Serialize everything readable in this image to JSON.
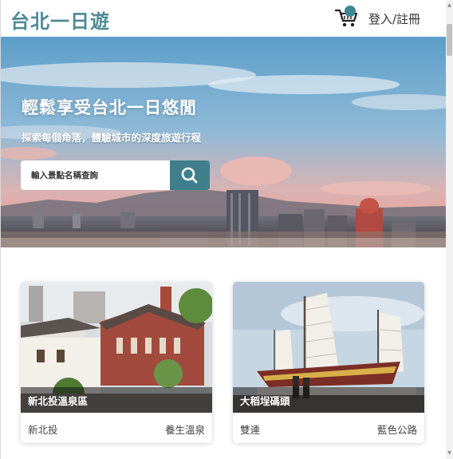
{
  "header": {
    "logo": "台北一日遊",
    "login_label": "登入/註冊",
    "cart_icon": "shopping-cart-icon"
  },
  "hero": {
    "title": "輕鬆享受台北一日悠閒",
    "subtitle": "探索每個角落，體驗城市的深度旅遊行程",
    "search_placeholder": "輸入景點名稱查詢",
    "search_icon": "search-icon"
  },
  "attractions": [
    {
      "name": "新北投溫泉區",
      "area": "新北投",
      "category": "養生溫泉"
    },
    {
      "name": "大稻埕碼頭",
      "area": "雙連",
      "category": "藍色公路"
    }
  ],
  "colors": {
    "brand": "#4f8a95",
    "search_button": "#3f7f8c"
  }
}
